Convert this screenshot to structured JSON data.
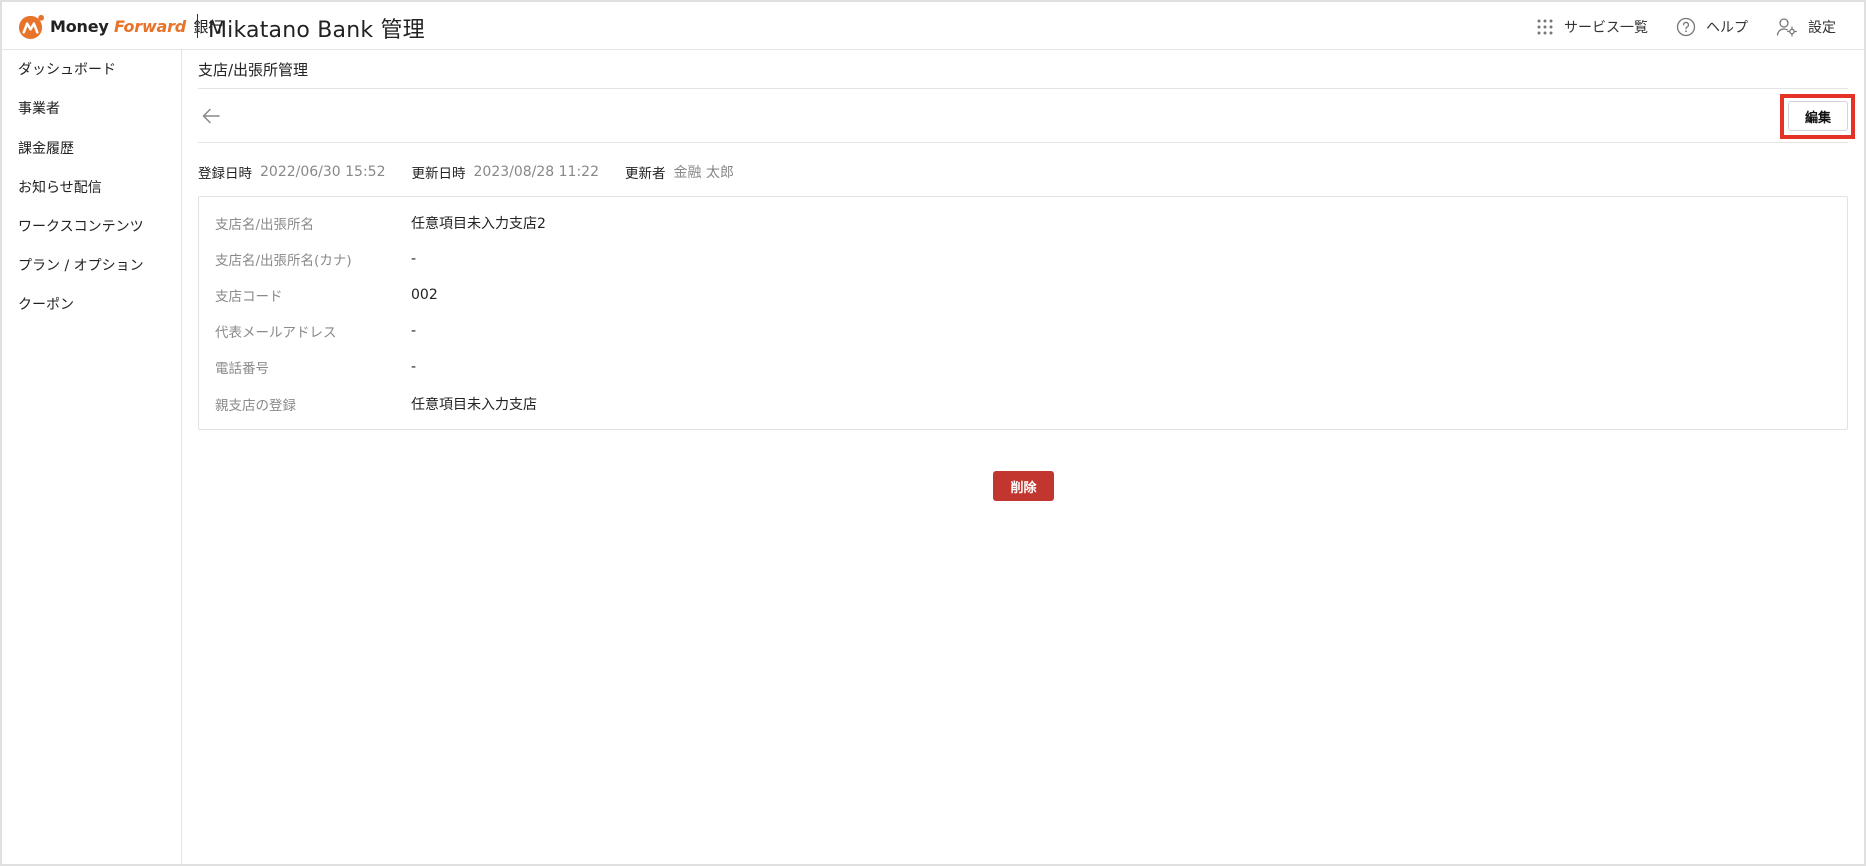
{
  "header": {
    "brand_money": "Money",
    "brand_forward": "Forward",
    "brand_bank": "銀行",
    "brand_product": "Mikatano Bank 管理",
    "nav": [
      {
        "label": "サービス一覧",
        "icon": "grid-icon"
      },
      {
        "label": "ヘルプ",
        "icon": "help-circle-icon"
      },
      {
        "label": "設定",
        "icon": "user-gear-icon"
      }
    ]
  },
  "colors": {
    "brand_orange": "#e8732a",
    "danger": "#c3352f",
    "highlight": "#e53227",
    "muted_text": "#888888"
  },
  "sidebar": {
    "items": [
      {
        "label": "ダッシュボード"
      },
      {
        "label": "事業者"
      },
      {
        "label": "課金履歴"
      },
      {
        "label": "お知らせ配信"
      },
      {
        "label": "ワークスコンテンツ"
      },
      {
        "label": "プラン / オプション"
      },
      {
        "label": "クーポン"
      }
    ]
  },
  "page": {
    "title": "支店/出張所管理",
    "edit_label": "編集",
    "delete_label": "削除",
    "meta": {
      "created_label": "登録日時",
      "created_value": "2022/06/30 15:52",
      "updated_label": "更新日時",
      "updated_value": "2023/08/28 11:22",
      "updater_label": "更新者",
      "updater_value": "金融 太郎"
    },
    "details": [
      {
        "label": "支店名/出張所名",
        "value": "任意項目未入力支店2"
      },
      {
        "label": "支店名/出張所名(カナ)",
        "value": "-"
      },
      {
        "label": "支店コード",
        "value": "002"
      },
      {
        "label": "代表メールアドレス",
        "value": "-"
      },
      {
        "label": "電話番号",
        "value": "-"
      },
      {
        "label": "親支店の登録",
        "value": "任意項目未入力支店"
      }
    ]
  }
}
